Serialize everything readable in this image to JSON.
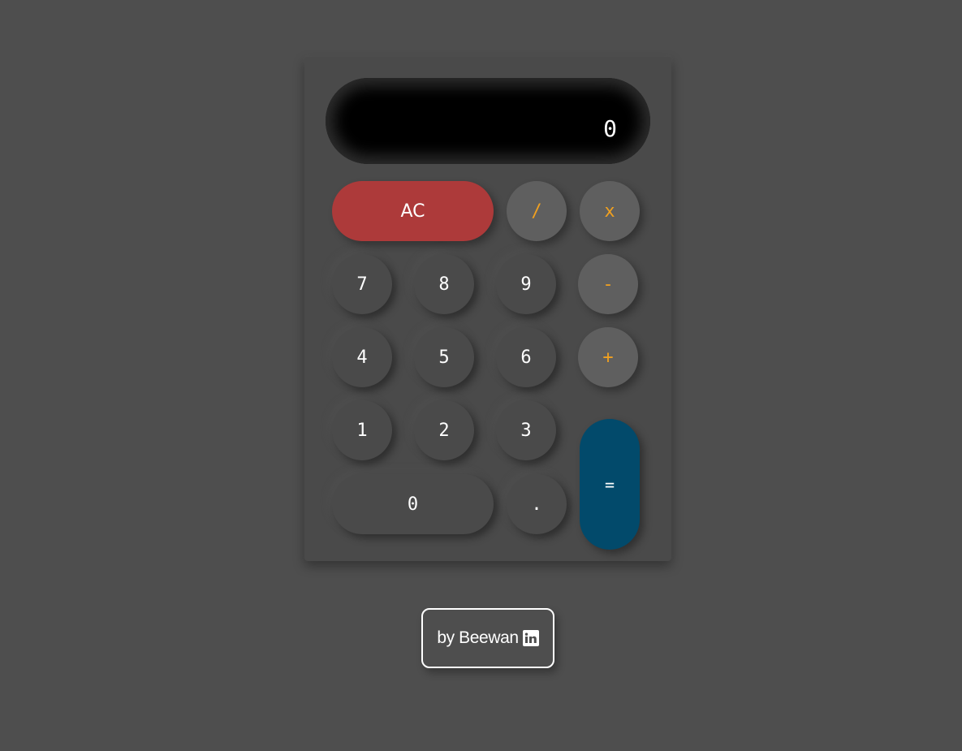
{
  "display": {
    "value": "0"
  },
  "buttons": {
    "clear": "AC",
    "divide": "/",
    "multiply": "x",
    "subtract": "-",
    "add": "+",
    "equals": "=",
    "decimal": ".",
    "digits": {
      "d0": "0",
      "d1": "1",
      "d2": "2",
      "d3": "3",
      "d4": "4",
      "d5": "5",
      "d6": "6",
      "d7": "7",
      "d8": "8",
      "d9": "9"
    }
  },
  "credit": {
    "text": "by Beewan",
    "icon": "linkedin-icon"
  },
  "colors": {
    "background": "#4e4e4e",
    "operator_text": "#f0a020",
    "clear_button": "#ad3a3a",
    "equals_button": "#024a6b"
  }
}
